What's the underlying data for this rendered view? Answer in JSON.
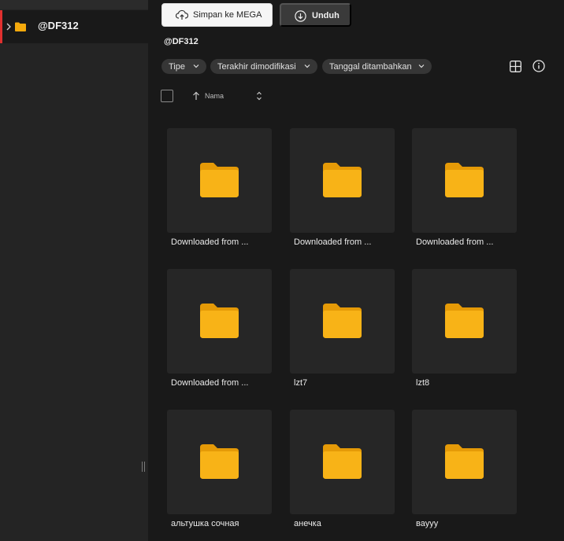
{
  "sidebar": {
    "tree": [
      {
        "label": "@DF312"
      }
    ]
  },
  "toolbar": {
    "save_label": "Simpan ke MEGA",
    "download_label": "Unduh"
  },
  "breadcrumb": "@DF312",
  "filters": [
    {
      "label": "Tipe"
    },
    {
      "label": "Terakhir dimodifikasi"
    },
    {
      "label": "Tanggal ditambahkan"
    }
  ],
  "sort": {
    "label": "Nama",
    "direction": "ascending"
  },
  "items": [
    {
      "name": "Downloaded from ...",
      "type": "folder"
    },
    {
      "name": "Downloaded from ...",
      "type": "folder"
    },
    {
      "name": "Downloaded from ...",
      "type": "folder"
    },
    {
      "name": "Downloaded from ...",
      "type": "folder"
    },
    {
      "name": "lzt7",
      "type": "folder"
    },
    {
      "name": "lzt8",
      "type": "folder"
    },
    {
      "name": "альтушка сочная",
      "type": "folder"
    },
    {
      "name": "анечка",
      "type": "folder"
    },
    {
      "name": "вауyy",
      "type": "folder"
    }
  ],
  "icons": {
    "folder": "folder-icon",
    "upload": "cloud-upload-icon",
    "download": "download-icon",
    "grid": "grid-view-icon",
    "info": "info-icon"
  },
  "colors": {
    "accent": "#e0302f",
    "folder": "#f5a90c",
    "background": "#191919",
    "sidebar": "#242424",
    "tile": "#262626"
  }
}
